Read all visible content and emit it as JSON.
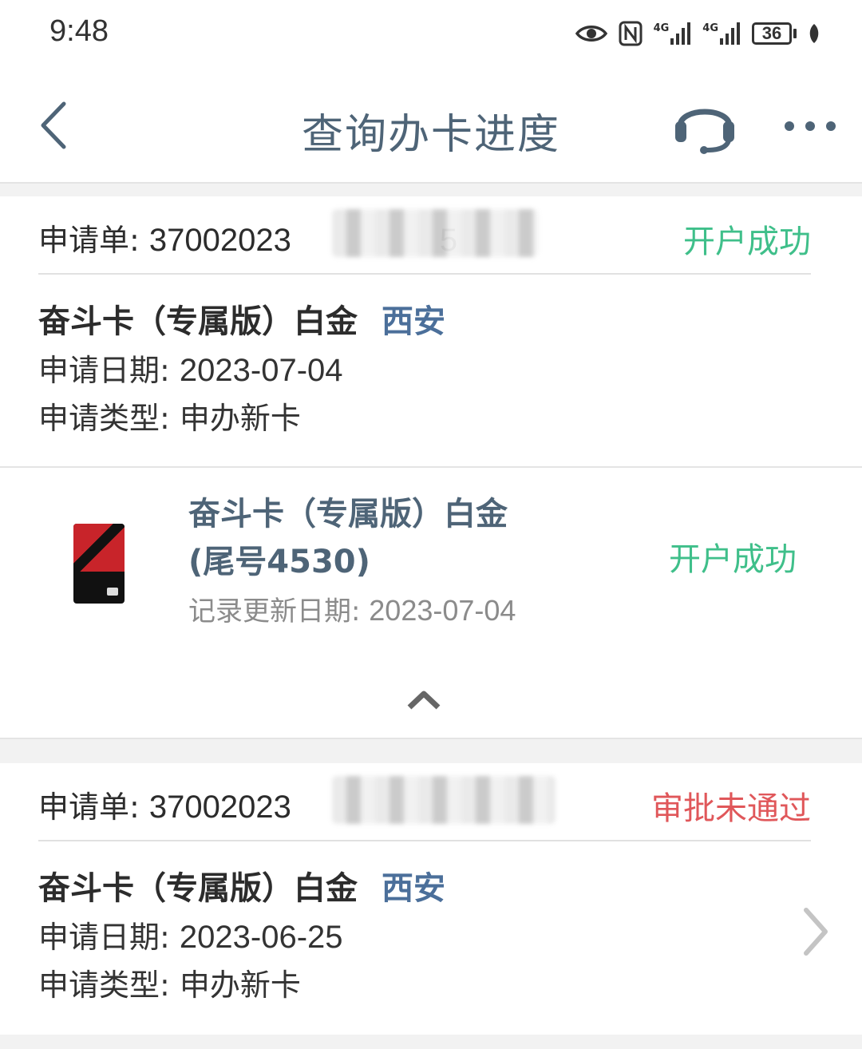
{
  "status_bar": {
    "time": "9:48",
    "battery": "36",
    "signal_1": "4G",
    "signal_2": "4G"
  },
  "header": {
    "title": "查询办卡进度",
    "icons": [
      "back-arrow-icon",
      "headset-icon",
      "more-icon"
    ]
  },
  "applications": [
    {
      "order_label": "申请单:",
      "order_number_visible": "37002023",
      "order_number_tail": "5",
      "status": "开户成功",
      "card_name": "奋斗卡（专属版）白金",
      "city": "西安",
      "date_label": "申请日期:",
      "date": "2023-07-04",
      "type_label": "申请类型:",
      "type": "申办新卡",
      "detail": {
        "card_name": "奋斗卡（专属版）白金",
        "card_tail": "(尾号4530)",
        "update_label": "记录更新日期:",
        "update_date": "2023-07-04",
        "status": "开户成功"
      }
    },
    {
      "order_label": "申请单:",
      "order_number_visible": "37002023",
      "status": "审批未通过",
      "card_name": "奋斗卡（专属版）白金",
      "city": "西安",
      "date_label": "申请日期:",
      "date": "2023-06-25",
      "type_label": "申请类型:",
      "type": "申办新卡"
    }
  ],
  "colors": {
    "success": "#3fbf8a",
    "failed": "#e0575a",
    "title_blue": "#4e6477",
    "city_blue": "#4b6f9a"
  }
}
